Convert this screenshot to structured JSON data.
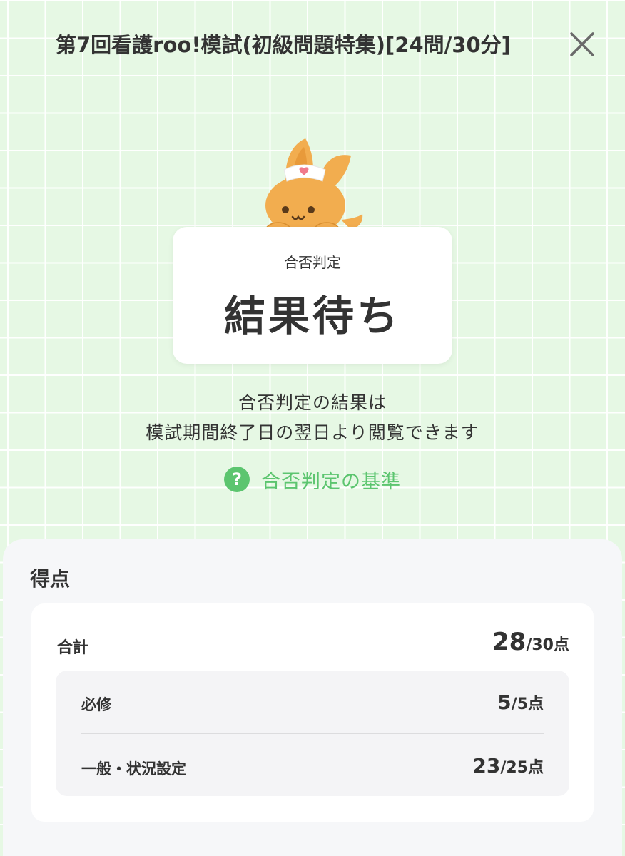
{
  "header": {
    "title": "第7回看護roo!模試(初級問題特集)[24問/30分]",
    "close_icon": "close-icon"
  },
  "result": {
    "label": "合否判定",
    "value": "結果待ち"
  },
  "notice": {
    "line1": "合否判定の結果は",
    "line2": "模試期間終了日の翌日より閲覧できます"
  },
  "criteria_link": {
    "icon": "question-icon",
    "text": "合否判定の基準"
  },
  "score": {
    "title": "得点",
    "total": {
      "label": "合計",
      "score": "28",
      "max": "/30点"
    },
    "items": [
      {
        "label": "必修",
        "score": "5",
        "max": "/5点"
      },
      {
        "label": "一般・状況設定",
        "score": "23",
        "max": "/25点"
      }
    ]
  },
  "colors": {
    "background": "#e6f8e4",
    "accent": "#5cc56f",
    "mascot": "#f2ad4f"
  }
}
